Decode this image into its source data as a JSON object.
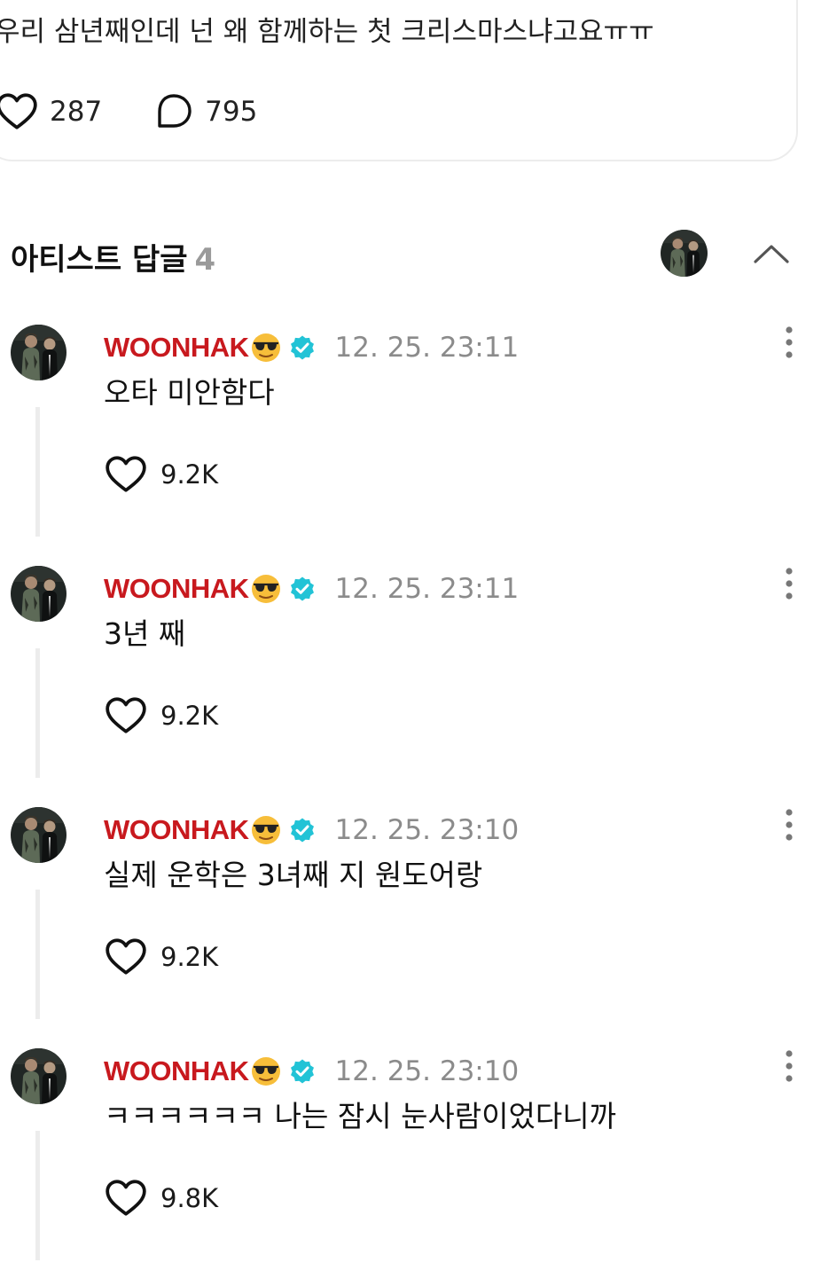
{
  "post": {
    "text": "우리 삼년째인데 넌 왜 함께하는 첫 크리스마스냐고요ㅠㅠ",
    "like_count": "287",
    "comment_count": "795"
  },
  "artist_replies": {
    "title": "아티스트 답글",
    "count": "4"
  },
  "colors": {
    "artist_name": "#c8191e",
    "verified_badge": "#22c3d6",
    "thread_line": "#ececec",
    "muted_text": "#8b8b8b"
  },
  "replies": [
    {
      "name": "WOONHAK",
      "timestamp": "12. 25. 23:11",
      "text": "오타 미안함다",
      "likes": "9.2K"
    },
    {
      "name": "WOONHAK",
      "timestamp": "12. 25. 23:11",
      "text": "3년 째",
      "likes": "9.2K"
    },
    {
      "name": "WOONHAK",
      "timestamp": "12. 25. 23:10",
      "text": "실제 운학은 3녀째 지 원도어랑",
      "likes": "9.2K"
    },
    {
      "name": "WOONHAK",
      "timestamp": "12. 25. 23:10",
      "text": "ㅋㅋㅋㅋㅋㅋ 나는 잠시 눈사람이었다니까",
      "likes": "9.8K"
    }
  ]
}
